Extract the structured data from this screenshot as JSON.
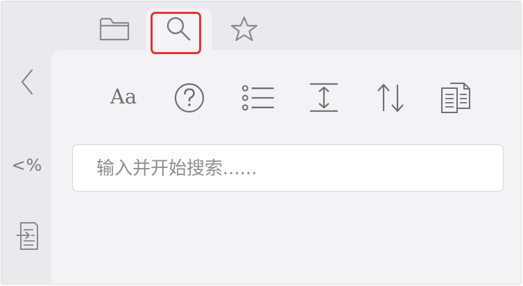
{
  "tabs": {
    "items": [
      {
        "name": "folder",
        "icon": "folder-icon",
        "selected": false
      },
      {
        "name": "search",
        "icon": "search-icon",
        "selected": true
      },
      {
        "name": "favorites",
        "icon": "star-icon",
        "selected": false
      }
    ]
  },
  "sidebar": {
    "back_icon": "chevron-left-icon",
    "percent_label": "<%",
    "import_icon": "import-document-icon"
  },
  "toolbar": {
    "font_label": "Aa",
    "items": [
      {
        "name": "font",
        "icon": "font-icon"
      },
      {
        "name": "help",
        "icon": "question-icon"
      },
      {
        "name": "list",
        "icon": "list-icon"
      },
      {
        "name": "line-spacing",
        "icon": "vertical-resize-icon"
      },
      {
        "name": "sort",
        "icon": "sort-icon"
      },
      {
        "name": "copy",
        "icon": "copy-document-icon"
      }
    ]
  },
  "search": {
    "placeholder": "输入并开始搜索......",
    "value": ""
  },
  "colors": {
    "background": "#e9e9ee",
    "panel": "#f3f3f7",
    "icon": "#707070",
    "highlight": "#e8322e"
  }
}
